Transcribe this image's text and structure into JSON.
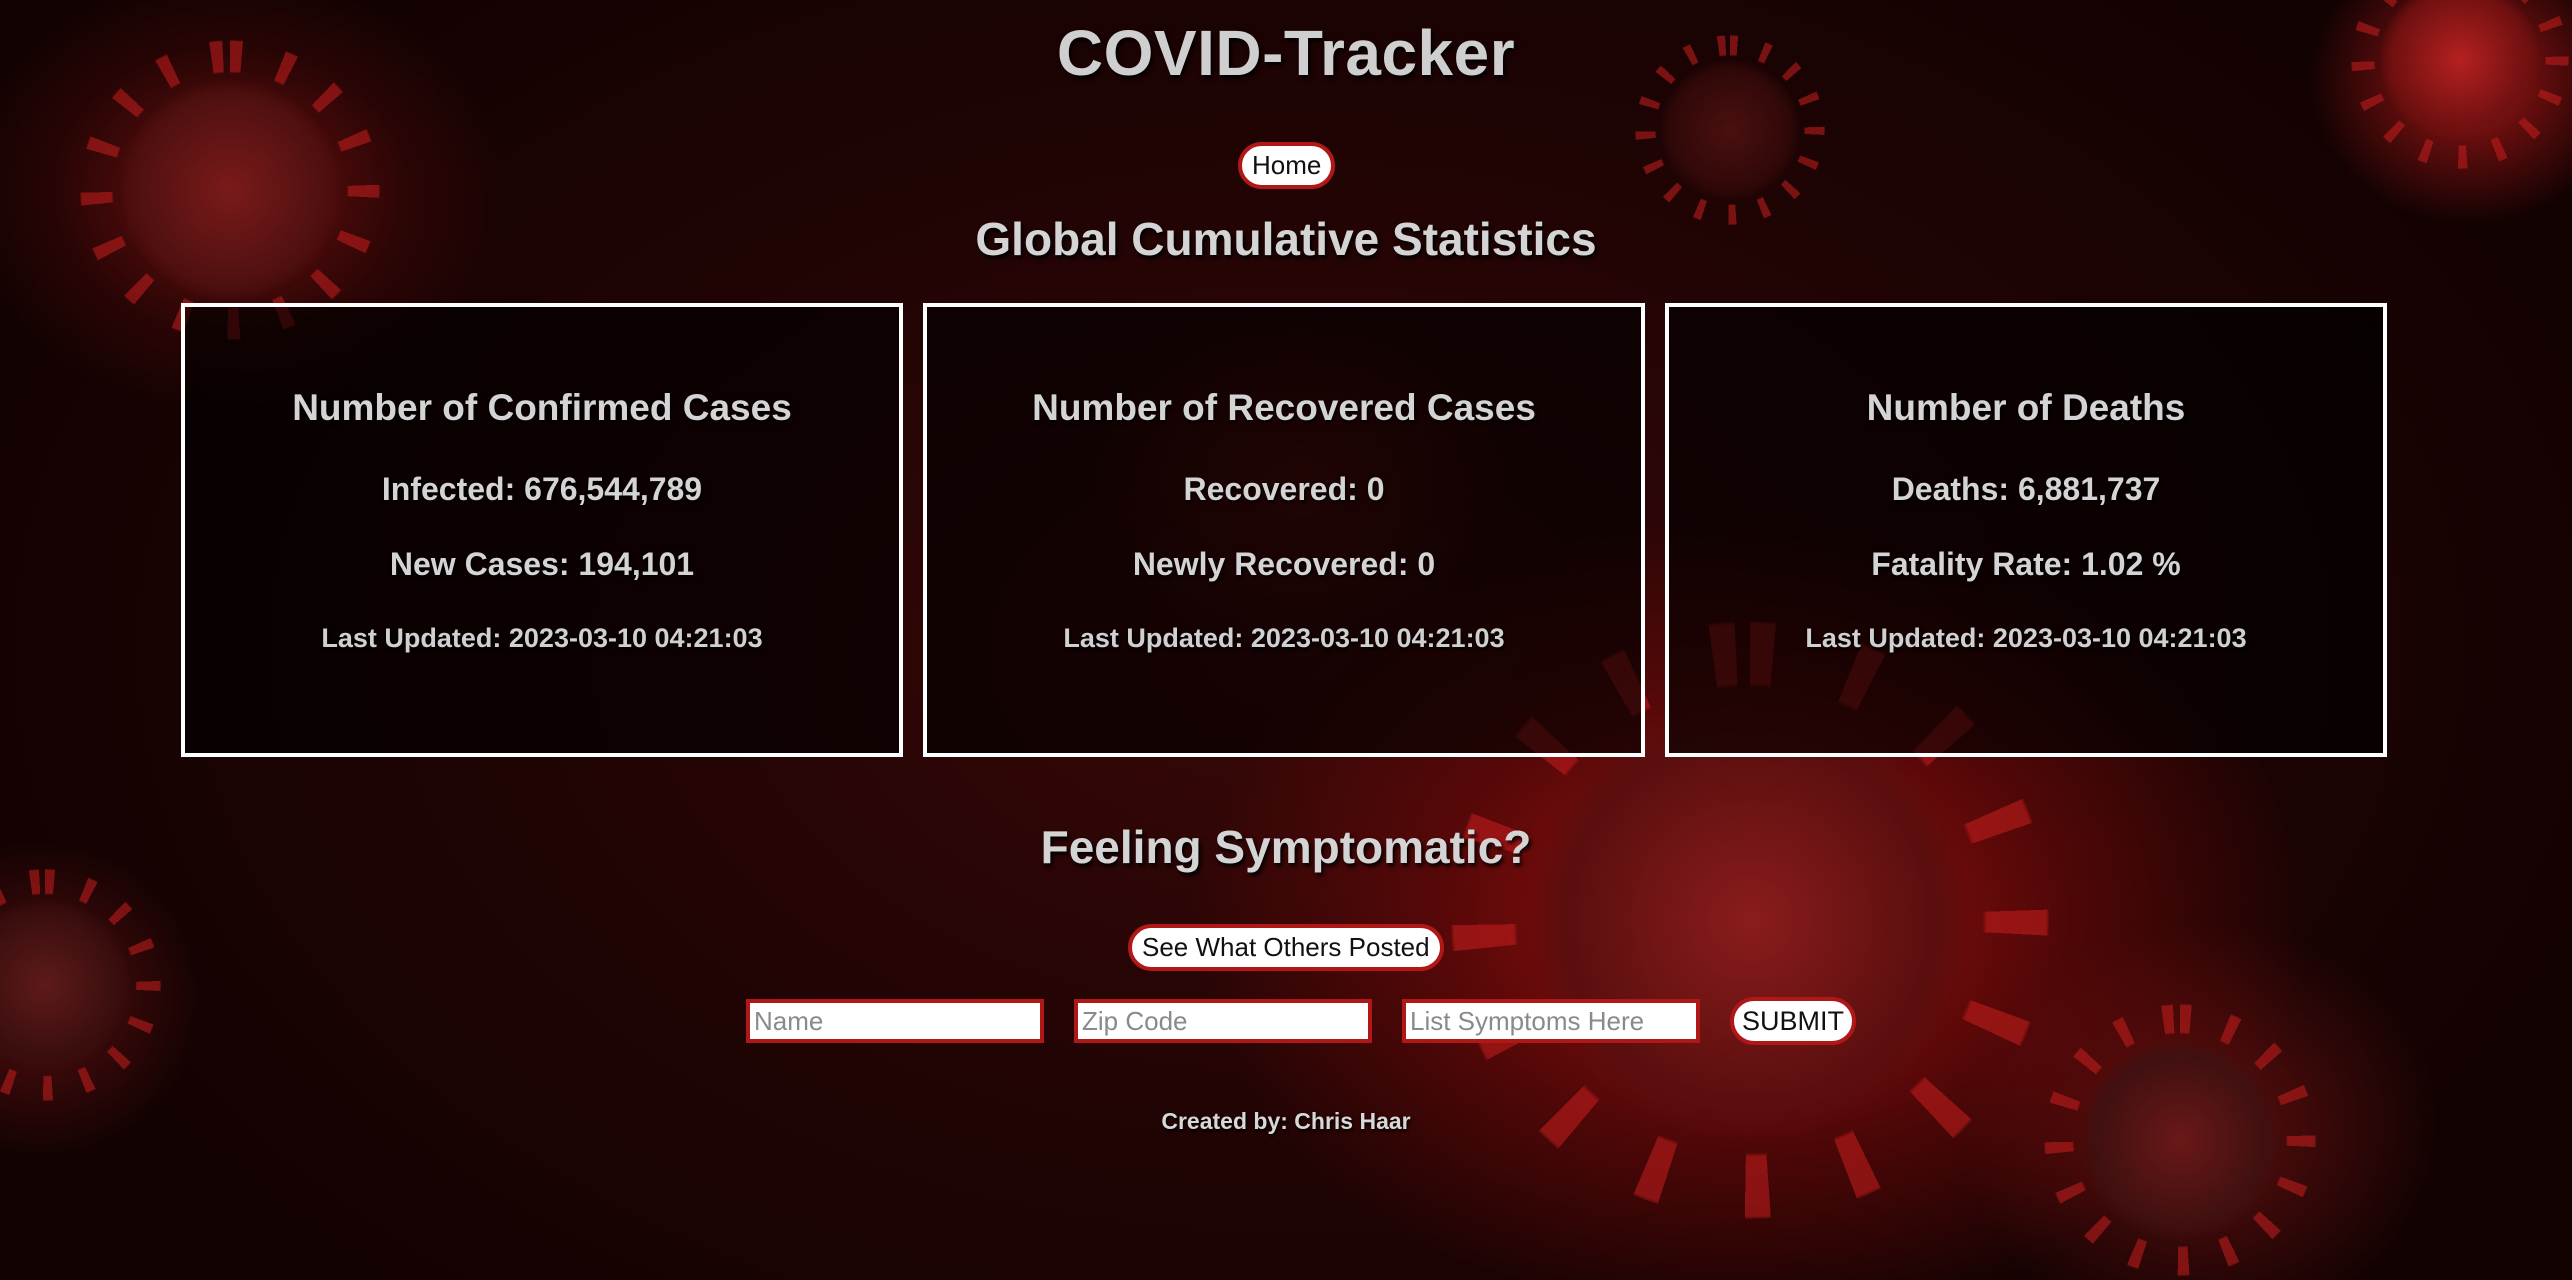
{
  "header": {
    "title": "COVID-Tracker",
    "nav": {
      "home_label": "Home"
    }
  },
  "stats": {
    "heading": "Global Cumulative Statistics",
    "cards": [
      {
        "title": "Number of Confirmed Cases",
        "primary": "Infected: 676,544,789",
        "secondary": "New Cases: 194,101",
        "updated": "Last Updated: 2023-03-10 04:21:03"
      },
      {
        "title": "Number of Recovered Cases",
        "primary": "Recovered: 0",
        "secondary": "Newly Recovered: 0",
        "updated": "Last Updated: 2023-03-10 04:21:03"
      },
      {
        "title": "Number of Deaths",
        "primary": "Deaths: 6,881,737",
        "secondary": "Fatality Rate: 1.02 %",
        "updated": "Last Updated: 2023-03-10 04:21:03"
      }
    ]
  },
  "symptoms": {
    "heading": "Feeling Symptomatic?",
    "see_others_label": "See What Others Posted",
    "form": {
      "name_placeholder": "Name",
      "zip_placeholder": "Zip Code",
      "symptoms_placeholder": "List Symptoms Here",
      "submit_label": "SUBMIT"
    }
  },
  "footer": {
    "credit": "Created by: Chris Haar"
  },
  "colors": {
    "accent_border": "#b01818",
    "card_border": "#ffffff",
    "background_dark": "#120202",
    "text": "#d4d4d4"
  }
}
